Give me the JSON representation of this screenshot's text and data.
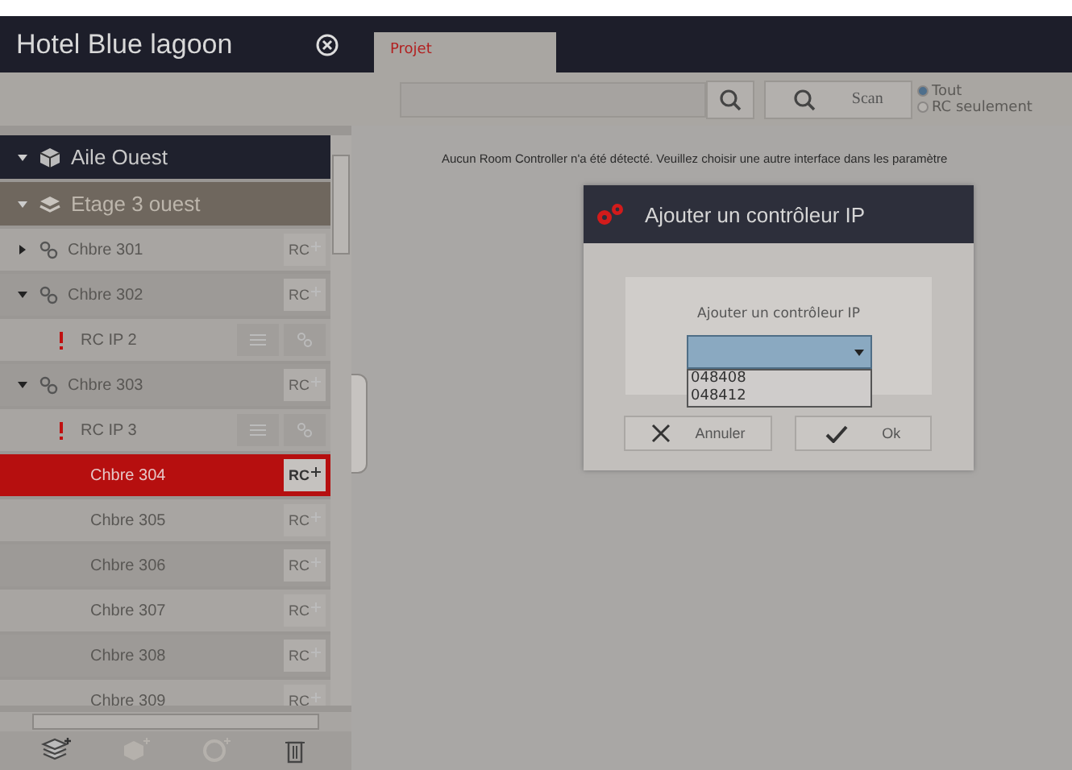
{
  "window": {
    "title": "Hotel Blue lagoon"
  },
  "tabs": [
    {
      "label": "Projet",
      "selected": true
    }
  ],
  "toolbar": {
    "scan_button": "Scan",
    "filters": [
      {
        "label": "Tout",
        "selected": true
      },
      {
        "label": "RC seulement",
        "selected": false
      }
    ]
  },
  "tree": [
    {
      "label": "Aile Ouest",
      "kind": "wing",
      "expanded": true,
      "children": [
        {
          "label": "Etage 3 ouest",
          "kind": "floor",
          "expanded": true,
          "children": [
            {
              "label": "Chbre 301",
              "kind": "linked-room",
              "expanded": false,
              "selected": false,
              "action": "RC"
            },
            {
              "label": "Chbre 302",
              "kind": "linked-room",
              "expanded": true,
              "selected": false,
              "action": "RC",
              "children": [
                {
                  "label": "RC IP 2",
                  "kind": "controller",
                  "selected": false
                }
              ]
            },
            {
              "label": "Chbre 303",
              "kind": "linked-room",
              "expanded": true,
              "selected": false,
              "action": "RC",
              "children": [
                {
                  "label": "RC IP 3",
                  "kind": "controller",
                  "selected": false
                }
              ]
            },
            {
              "label": "Chbre 304",
              "kind": "room",
              "selected": true,
              "action": "RC"
            },
            {
              "label": "Chbre 305",
              "kind": "room",
              "selected": false,
              "action": "RC"
            },
            {
              "label": "Chbre 306",
              "kind": "room",
              "selected": false,
              "action": "RC"
            },
            {
              "label": "Chbre 307",
              "kind": "room",
              "selected": false,
              "action": "RC"
            },
            {
              "label": "Chbre 308",
              "kind": "room",
              "selected": false,
              "action": "RC"
            },
            {
              "label": "Chbre 309",
              "kind": "room",
              "selected": false,
              "action": "RC"
            }
          ]
        }
      ]
    }
  ],
  "message": "Aucun Room Controller n'a été détecté. Veuillez choisir une autre interface dans les paramètre",
  "dialog": {
    "title": "Ajouter un contrôleur IP",
    "label": "Ajouter un contrôleur IP",
    "dropdown": {
      "expanded": true,
      "options": [
        "048408",
        "048412"
      ]
    },
    "buttons": [
      {
        "label": "Annuler",
        "kind": "cancel"
      },
      {
        "label": "Ok",
        "kind": "ok"
      }
    ]
  }
}
